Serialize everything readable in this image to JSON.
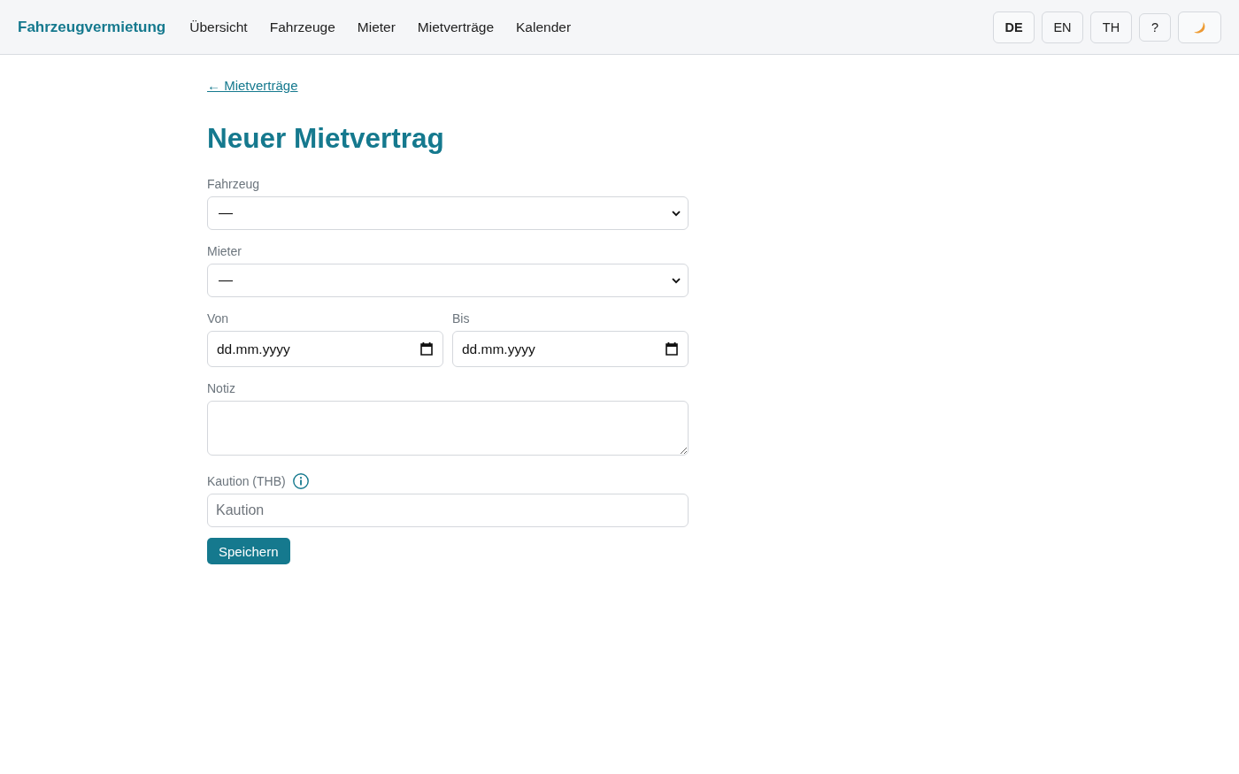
{
  "header": {
    "brand": "Fahrzeugvermietung",
    "nav_links": [
      "Übersicht",
      "Fahrzeuge",
      "Mieter",
      "Mietverträge",
      "Kalender"
    ],
    "languages": [
      {
        "label": "DE",
        "selected": true
      },
      {
        "label": "EN",
        "selected": false
      },
      {
        "label": "TH",
        "selected": false
      }
    ],
    "help_button": "?"
  },
  "page": {
    "back_link": "← Mietverträge",
    "title": "Neuer Mietvertrag",
    "fields": [
      {
        "kind": "select",
        "label": "Fahrzeug",
        "value": "—"
      },
      {
        "kind": "select",
        "label": "Mieter",
        "value": "—"
      },
      {
        "kind": "date",
        "label": "Von",
        "placeholder": "dd.mm.yyyy"
      },
      {
        "kind": "date",
        "label": "Bis",
        "placeholder": "dd.mm.yyyy"
      },
      {
        "kind": "textarea",
        "label": "Notiz"
      },
      {
        "kind": "text",
        "label": "Kaution (THB)",
        "info": true,
        "placeholder": "Kaution"
      }
    ],
    "submit_button": "Speichern"
  }
}
